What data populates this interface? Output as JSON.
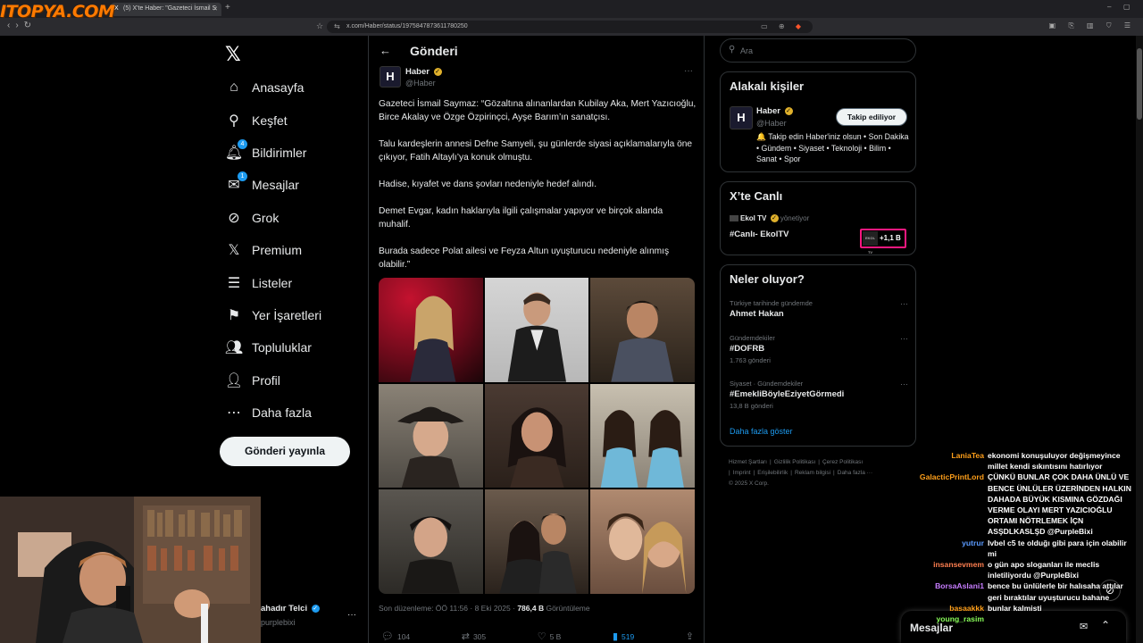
{
  "watermark": "ITOPYA.COM",
  "browser": {
    "tab_title": "(5) X'te Haber: \"Gazeteci İsmail S",
    "url": "x.com/Haber/status/1975847873611780250"
  },
  "nav": {
    "items": [
      {
        "label": "Anasayfa",
        "icon": "home-icon",
        "glyph": "⌂"
      },
      {
        "label": "Keşfet",
        "icon": "search-icon",
        "glyph": "⚲"
      },
      {
        "label": "Bildirimler",
        "icon": "bell-icon",
        "glyph": "🔔︎",
        "badge": "4"
      },
      {
        "label": "Mesajlar",
        "icon": "mail-icon",
        "glyph": "✉",
        "badge": "1"
      },
      {
        "label": "Grok",
        "icon": "grok-icon",
        "glyph": "⊘"
      },
      {
        "label": "Premium",
        "icon": "x-premium-icon",
        "glyph": "𝕏"
      },
      {
        "label": "Listeler",
        "icon": "list-icon",
        "glyph": "☰"
      },
      {
        "label": "Yer İşaretleri",
        "icon": "bookmark-icon",
        "glyph": "⚑"
      },
      {
        "label": "Topluluklar",
        "icon": "communities-icon",
        "glyph": "👥︎"
      },
      {
        "label": "Profil",
        "icon": "profile-icon",
        "glyph": "👤︎"
      },
      {
        "label": "Daha fazla",
        "icon": "more-icon",
        "glyph": "⋯"
      }
    ],
    "post_button": "Gönderi yayınla"
  },
  "main": {
    "title": "Gönderi",
    "author_name": "Haber",
    "author_handle": "@Haber",
    "avatar_letter": "H",
    "paragraphs": [
      "Gazeteci İsmail Saymaz: “Gözaltına alınanlardan Kubilay Aka, Mert Yazıcıoğlu, Birce Akalay ve Özge Özpirinçci, Ayşe Barım’ın sanatçısı.",
      "Talu kardeşlerin annesi Defne Samyeli, şu günlerde siyasi açıklamalarıyla öne çıkıyor, Fatih Altaylı’ya konuk olmuştu.",
      "Hadise, kıyafet ve dans şovları nedeniyle hedef alındı.",
      "Demet Evgar, kadın haklarıyla ilgili çalışmalar yapıyor ve birçok alanda muhalif.",
      "Burada sadece Polat ailesi ve Feyza Altun uyuşturucu nedeniyle alınmış olabilir.”"
    ],
    "meta_edited": "Son düzenleme: ÖÖ 11:56 · 8 Eki 2025 ·",
    "meta_views": "786,4 B",
    "meta_views_label": "Görüntüleme",
    "actions": {
      "replies": "104",
      "reposts": "305",
      "likes": "5 B",
      "bookmarks": "519"
    }
  },
  "right": {
    "search_placeholder": "Ara",
    "related_title": "Alakalı kişiler",
    "related_name": "Haber",
    "related_handle": "@Haber",
    "related_button": "Takip ediliyor",
    "related_bio": "🔔 Takip edin Haber'iniz olsun • Son Dakika • Gündem • Siyaset • Teknoloji • Bilim • Sanat • Spor",
    "live_title": "X’te Canlı",
    "live_channel": "Ekol TV",
    "live_suffix": "yönetiyor",
    "live_stream": "#Canlı- EkolTV",
    "live_viewers": "+1,1 B",
    "live_thumb": "EKOL TV",
    "trends_title": "Neler oluyor?",
    "trends": [
      {
        "context": "Türkiye tarihinde gündemde",
        "name": "Ahmet Hakan",
        "count": ""
      },
      {
        "context": "Gündemdekiler",
        "name": "#DOFRB",
        "count": "1.763 gönderi"
      },
      {
        "context": "Siyaset · Gündemdekiler",
        "name": "#EmekliBöyleEziyetGörmedi",
        "count": "13,8 B gönderi"
      }
    ],
    "show_more": "Daha fazla göster",
    "footer": [
      "Hizmet Şartları",
      "|",
      "Gizlilik Politikası",
      "|",
      "Çerez Politikası",
      "|",
      "Imprint",
      "|",
      "Erişilebilirlik",
      "|",
      "Reklam bilgisi",
      "|",
      "Daha fazla ···",
      "© 2025 X Corp."
    ]
  },
  "account": {
    "name": "ahadır Telci",
    "handle": "purplebixi"
  },
  "messages_label": "Mesajlar",
  "chat": [
    {
      "user": "LaniaTea",
      "color": "#ff9f1a",
      "msg": "ekonomi konuşuluyor değişmeyince millet kendi sıkıntısını hatırlıyor"
    },
    {
      "user": "GalacticPrintLord",
      "color": "#ff9f1a",
      "msg": "ÇÜNKÜ BUNLAR ÇOK DAHA ÜNLÜ VE BENCE ÜNLÜLER ÜZERİNDEN HALKIN DAHADA BÜYÜK KISMINA GÖZDAĞI VERME OLAYI MERT YAZICIOĞLU ORTAMI NÖTRLEMEK İÇN ASŞDLKASLŞD @PurpleBixi"
    },
    {
      "user": "yutrur",
      "color": "#5b9bff",
      "msg": "Ivbel c5 te olduğı gibi para için olabilir mi"
    },
    {
      "user": "insansevmem",
      "color": "#ff7f50",
      "msg": "o gün apo sloganları ile meclis inletiliyordu @PurpleBixi"
    },
    {
      "user": "BorsaAslani1",
      "color": "#c77dff",
      "msg": "bence bu ünlülerle bir halısaha attılar geri bıraktılar uyuşturucu bahane"
    },
    {
      "user": "basaakkk",
      "color": "#ff9f1a",
      "msg": "bunlar kalmisti"
    },
    {
      "user": "young_rasim",
      "color": "#8aff5a",
      "msg": ""
    }
  ]
}
